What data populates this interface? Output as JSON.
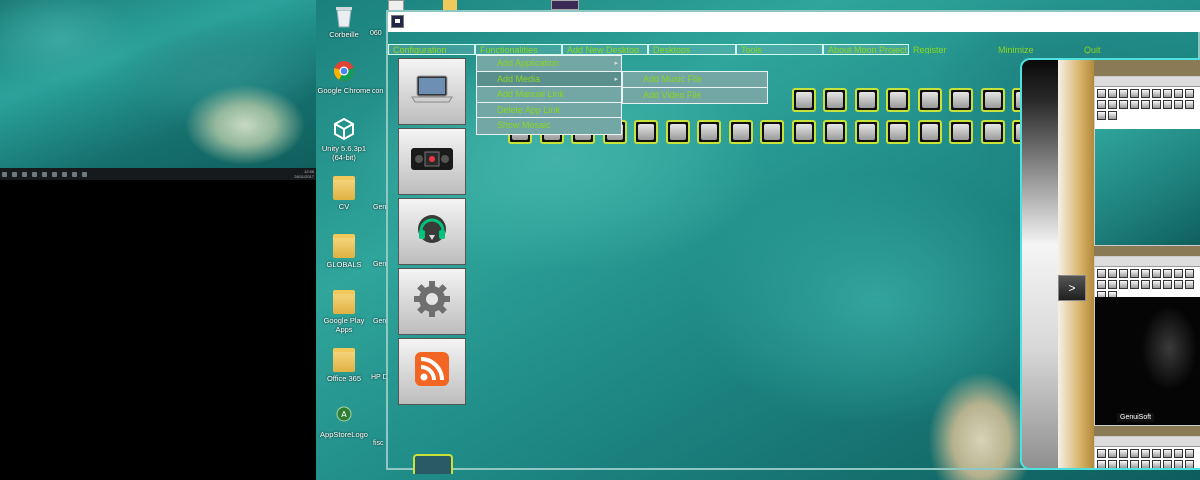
{
  "left_monitor": {
    "clock_time": "12:55",
    "clock_date": "28/11/2017"
  },
  "desktop_icons": [
    {
      "name": "recycle-bin-icon",
      "label": "Corbeille"
    },
    {
      "name": "chrome-icon",
      "label": "Google Chrome"
    },
    {
      "name": "unity-icon",
      "label": "Unity 5.6.3p1 (64-bit)"
    },
    {
      "name": "folder-icon",
      "label": "CV"
    },
    {
      "name": "folder-icon",
      "label": "GLOBALS"
    },
    {
      "name": "folder-icon",
      "label": "Google Play Apps"
    },
    {
      "name": "folder-icon",
      "label": "Office 365"
    },
    {
      "name": "appstore-logo-icon",
      "label": "AppStoreLogo"
    }
  ],
  "desktop_truncated": [
    "060",
    "con",
    "Gen",
    "Gen",
    "Gen",
    "HP D",
    "fisc"
  ],
  "menubar": [
    {
      "label": "Configuration"
    },
    {
      "label": "Functionalities"
    },
    {
      "label": "Add New Desktop"
    },
    {
      "label": "Desktops"
    },
    {
      "label": "Tools"
    },
    {
      "label": "About Moon Project"
    },
    {
      "label": "Register"
    },
    {
      "label": "Minimize"
    },
    {
      "label": "Quit"
    }
  ],
  "functionalities_menu": [
    {
      "label": "Add Application",
      "has_submenu": true
    },
    {
      "label": "Add Media",
      "has_submenu": true
    },
    {
      "label": "Add Manual Link",
      "has_submenu": false
    },
    {
      "label": "Delete App Link",
      "has_submenu": false
    },
    {
      "label": "Show Mosaic",
      "has_submenu": false
    }
  ],
  "media_submenu": [
    {
      "label": "Add Music File"
    },
    {
      "label": "Add Video File"
    }
  ],
  "sidebar_tiles": [
    {
      "icon": "laptop-icon"
    },
    {
      "icon": "media-player-icon"
    },
    {
      "icon": "headphones-icon"
    },
    {
      "icon": "settings-gear-icon"
    },
    {
      "icon": "rss-icon"
    }
  ],
  "right_panel": {
    "next_arrow": ">",
    "brand": "GenuiSoft"
  },
  "colors": {
    "menu_text": "#8bd61e",
    "dropdown_bg": "#73a7a6",
    "panel_border": "#4fe0e0",
    "tile_border": "#c8e23a"
  }
}
